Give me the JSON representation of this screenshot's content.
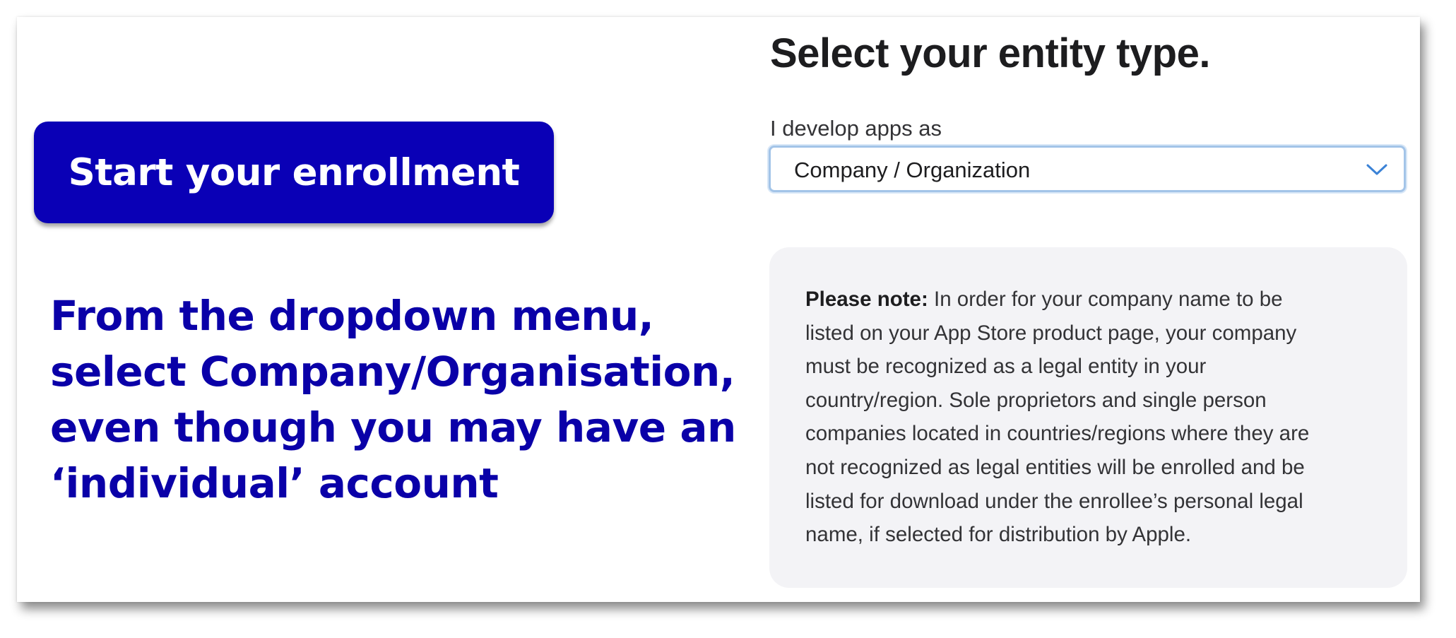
{
  "left_panel": {
    "cta_label": "Start your enrollment",
    "instruction_lines": [
      "From the dropdown menu,",
      "select Company/Organisation,",
      "even though you may have an",
      "‘individual’ account"
    ],
    "brand_color": "#0a00b6"
  },
  "form": {
    "title": "Select your entity type.",
    "field_label": "I develop apps as",
    "select": {
      "selected_value": "Company / Organization",
      "icon": "chevron-down-icon"
    }
  },
  "note": {
    "heading": "Please note:",
    "lines": [
      " In order for your company name to be",
      "listed on your App Store product page, your company",
      "must be recognized as a legal entity in your",
      "country/region. Sole proprietors and single person",
      "companies located in countries/regions where they are",
      "not recognized as legal entities will be enrolled and be",
      "listed for download under the enrollee’s personal legal",
      "name, if selected for distribution by Apple."
    ]
  }
}
